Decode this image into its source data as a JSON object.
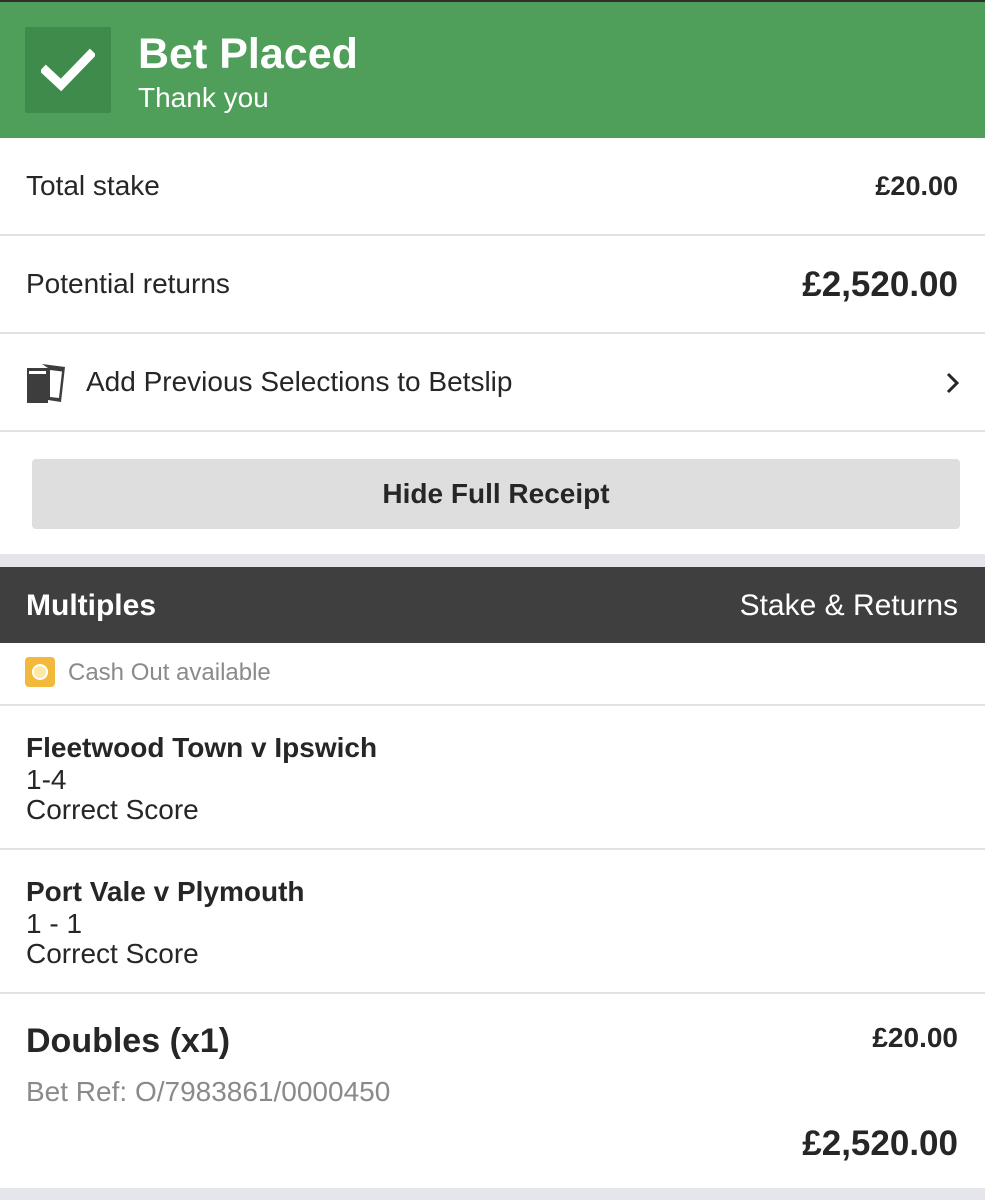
{
  "header": {
    "title": "Bet Placed",
    "subtitle": "Thank you",
    "icon": "checkmark-icon",
    "color": "#4f9f5a"
  },
  "summary": {
    "total_stake_label": "Total stake",
    "total_stake_value": "£20.00",
    "potential_returns_label": "Potential returns",
    "potential_returns_value": "£2,520.00"
  },
  "add_previous": {
    "label": "Add Previous Selections to Betslip",
    "icon": "betslip-cards-icon",
    "chevron": "chevron-right-icon"
  },
  "hide_receipt_button": "Hide Full Receipt",
  "section": {
    "left": "Multiples",
    "right": "Stake & Returns"
  },
  "cash_out": {
    "label": "Cash Out available",
    "icon": "cash-out-coin-icon",
    "color": "#f2b93b"
  },
  "selections": [
    {
      "match": "Fleetwood Town v Ipswich",
      "score": "1-4",
      "market": "Correct Score"
    },
    {
      "match": "Port Vale v Plymouth",
      "score": "1 - 1",
      "market": "Correct Score"
    }
  ],
  "bet": {
    "type": "Doubles (x1)",
    "stake": "£20.00",
    "ref": "Bet Ref: O/7983861/0000450",
    "returns": "£2,520.00"
  }
}
